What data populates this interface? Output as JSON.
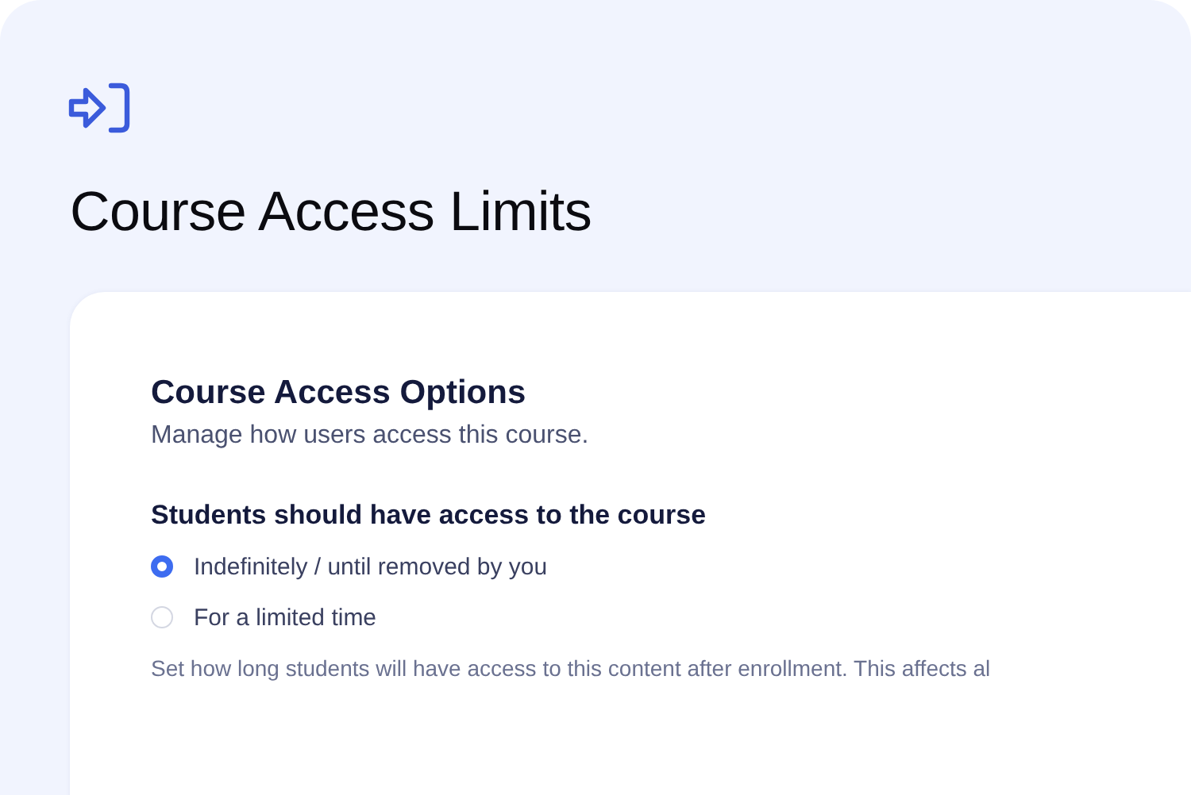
{
  "page": {
    "title": "Course Access Limits"
  },
  "card": {
    "heading": "Course Access Options",
    "subtitle": "Manage how users access this course.",
    "question": "Students should have access to the course",
    "options": [
      {
        "label": "Indefinitely / until removed by you",
        "selected": true
      },
      {
        "label": "For a limited time",
        "selected": false
      }
    ],
    "help": "Set how long students will have access to this content after enrollment. This affects al"
  }
}
